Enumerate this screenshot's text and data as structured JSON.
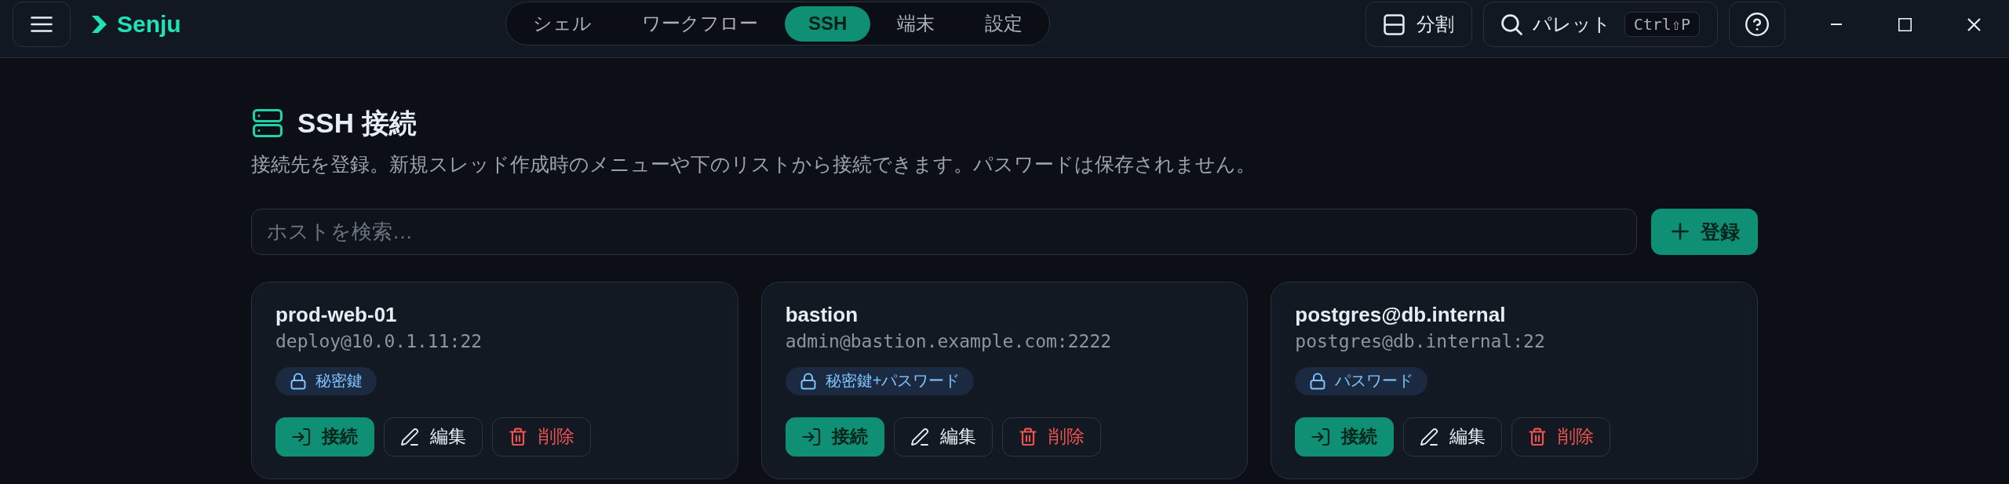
{
  "app": {
    "title": "Senju"
  },
  "nav_tabs": [
    {
      "label": "シェル",
      "selected": false
    },
    {
      "label": "ワークフロー",
      "selected": false
    },
    {
      "label": "SSH",
      "selected": true
    },
    {
      "label": "端末",
      "selected": false
    },
    {
      "label": "設定",
      "selected": false
    }
  ],
  "toolbar": {
    "split_label": "分割",
    "palette": {
      "label": "パレット",
      "shortcut": "Ctrl⇧P"
    }
  },
  "page": {
    "title": "SSH 接続",
    "description": "接続先を登録。新規スレッド作成時のメニューや下のリストから接続できます。パスワードは保存されません。"
  },
  "search": {
    "placeholder": "ホストを検索…"
  },
  "add_button": {
    "label": "登録"
  },
  "hosts": [
    {
      "name": "prod-web-01",
      "address": "deploy@10.0.1.11:22",
      "auth": "秘密鍵",
      "actions": [
        {
          "kind": "connect",
          "label": "接続"
        },
        {
          "kind": "edit",
          "label": "編集"
        },
        {
          "kind": "delete",
          "label": "削除"
        }
      ]
    },
    {
      "name": "bastion",
      "address": "admin@bastion.example.com:2222",
      "auth": "秘密鍵+パスワード",
      "actions": [
        {
          "kind": "connect",
          "label": "接続"
        },
        {
          "kind": "edit",
          "label": "編集"
        },
        {
          "kind": "delete",
          "label": "削除"
        }
      ]
    },
    {
      "name": "postgres@db.internal",
      "address": "postgres@db.internal:22",
      "auth": "パスワード",
      "actions": [
        {
          "kind": "connect",
          "label": "接続"
        },
        {
          "kind": "edit",
          "label": "編集"
        },
        {
          "kind": "delete",
          "label": "削除"
        }
      ]
    }
  ]
}
